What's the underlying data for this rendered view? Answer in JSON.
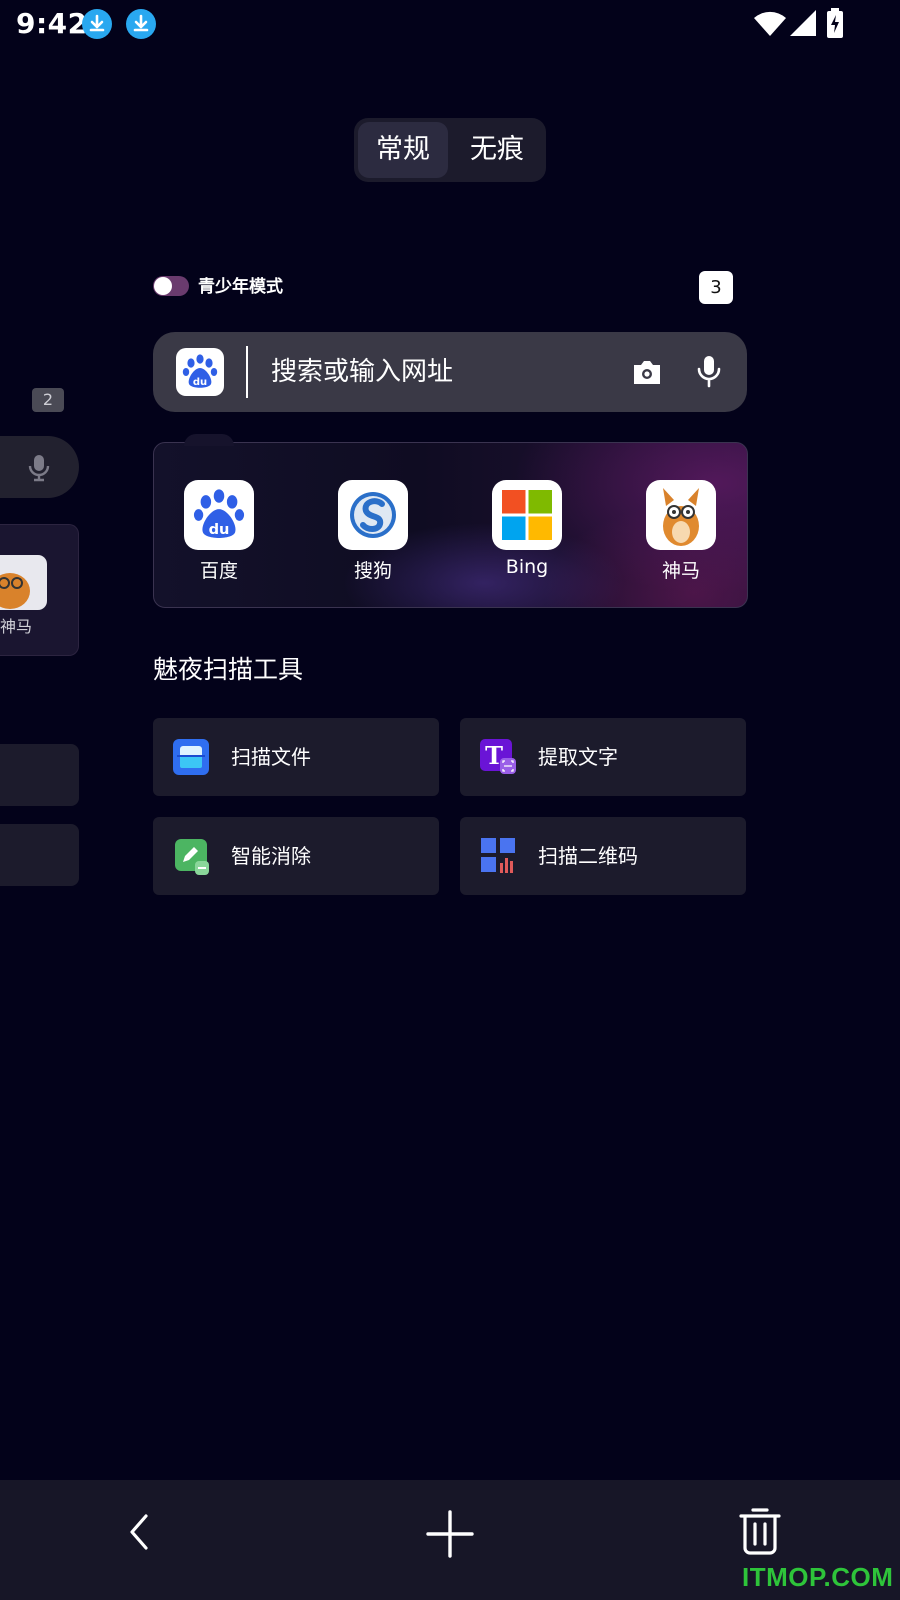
{
  "status_bar": {
    "time": "9:42",
    "icons": [
      "download-icon",
      "download-icon",
      "wifi-icon",
      "signal-icon",
      "battery-charging-icon"
    ]
  },
  "mode_switch": {
    "active": "常规",
    "other": "无痕"
  },
  "background_tab": {
    "badge": "2",
    "app_label": "神马"
  },
  "teen_mode": {
    "label": "青少年模式",
    "enabled": false
  },
  "tab_count": "3",
  "search": {
    "placeholder": "搜索或输入网址",
    "engine_icon": "baidu-paw-icon"
  },
  "quick_apps": [
    {
      "label": "百度",
      "icon": "baidu-icon"
    },
    {
      "label": "搜狗",
      "icon": "sogou-icon"
    },
    {
      "label": "Bing",
      "icon": "microsoft-icon"
    },
    {
      "label": "神马",
      "icon": "shenma-icon"
    }
  ],
  "tools": {
    "title": "魅夜扫描工具",
    "items": [
      {
        "label": "扫描文件",
        "icon": "scan-document-icon"
      },
      {
        "label": "提取文字",
        "icon": "extract-text-icon"
      },
      {
        "label": "智能消除",
        "icon": "smart-erase-icon"
      },
      {
        "label": "扫描二维码",
        "icon": "qr-scan-icon"
      }
    ]
  },
  "bottom_nav": [
    "back-icon",
    "add-tab-icon",
    "trash-icon"
  ],
  "colors": {
    "background": "#03021a",
    "card": "#1c1b2c",
    "search_bar": "#3a3946",
    "toggle": "#6a3b6e",
    "watermark": "#2ec43a"
  },
  "watermark": "ITMOP.COM"
}
